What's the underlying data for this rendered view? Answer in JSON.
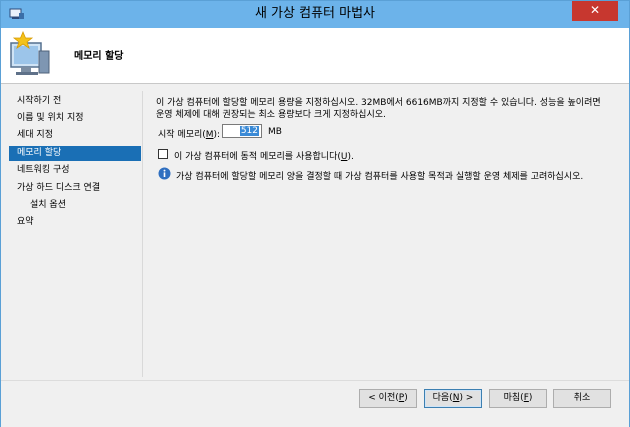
{
  "window": {
    "title": "새 가상 컴퓨터 마법사",
    "close_glyph": "✕"
  },
  "header": {
    "title": "메모리 할당"
  },
  "nav": {
    "items": [
      {
        "label": "시작하기 전",
        "active": false
      },
      {
        "label": "이름 및 위치 지정",
        "active": false
      },
      {
        "label": "세대 지정",
        "active": false
      },
      {
        "label": "메모리 할당",
        "active": true
      },
      {
        "label": "네트워킹 구성",
        "active": false
      },
      {
        "label": "가상 하드 디스크 연결",
        "active": false
      },
      {
        "label": "설치 옵션",
        "active": false
      },
      {
        "label": "요약",
        "active": false
      }
    ]
  },
  "content": {
    "description_line1": "이 가상 컴퓨터에 할당할 메모리 용량을 지정하십시오. 32MB에서 6616MB까지 지정할 수 있습니다. 성능을 높이려면",
    "description_line2": "운영 체제에 대해 권장되는 최소 용량보다 크게 지정하십시오.",
    "startup_memory_label": "시작 메모리(",
    "startup_memory_hotkey": "M",
    "startup_memory_label_end": "):",
    "startup_memory_value": "512",
    "startup_memory_unit": "MB",
    "dynamic_memory_label": "이 가상 컴퓨터에 동적 메모리를 사용합니다(",
    "dynamic_memory_hotkey": "U",
    "dynamic_memory_label_end": ").",
    "dynamic_memory_checked": false,
    "info_text": "가상 컴퓨터에 할당할 메모리 양을 결정할 때 가상 컴퓨터를 사용할 목적과 실행할 운영 체제를 고려하십시오."
  },
  "buttons": {
    "previous": {
      "label": "< 이전(",
      "hotkey": "P",
      "end": ")"
    },
    "next": {
      "label": "다음(",
      "hotkey": "N",
      "end": ") >"
    },
    "finish": {
      "label": "마침(",
      "hotkey": "F",
      "end": ")"
    },
    "cancel": {
      "label": "취소"
    }
  },
  "colors": {
    "titlebar": "#6cb3ea",
    "close": "#c7372f",
    "nav_active": "#1a6fb5"
  }
}
